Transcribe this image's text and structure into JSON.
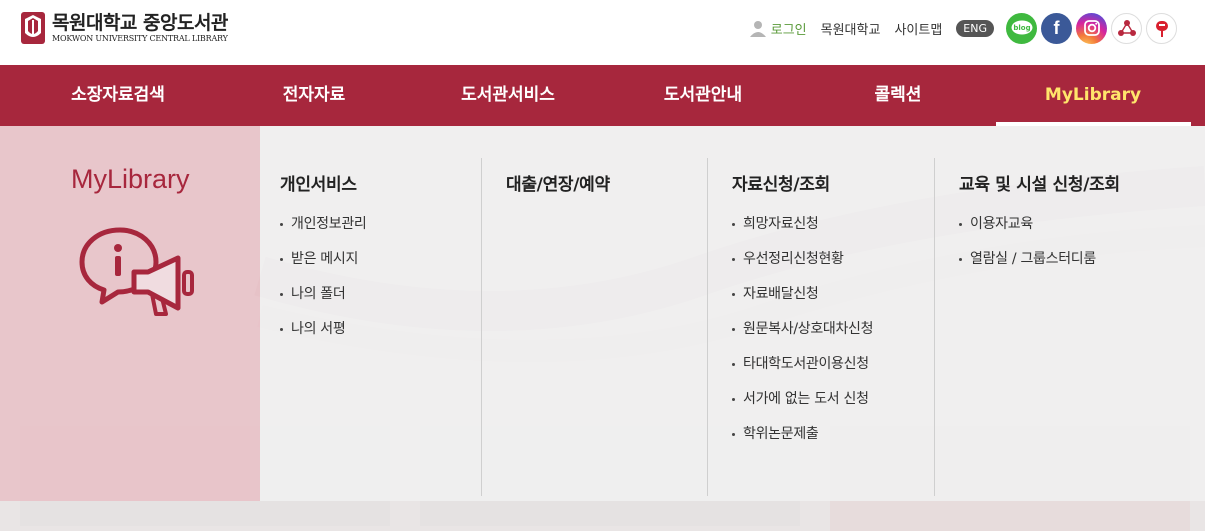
{
  "header": {
    "logo_kr": "목원대학교 중앙도서관",
    "logo_en": "MOKWON UNIVERSITY CENTRAL LIBRARY",
    "util": {
      "login": "로그인",
      "university": "목원대학교",
      "sitemap": "사이트맵",
      "lang": "ENG"
    },
    "sns": [
      {
        "name": "blog-icon",
        "glyph": "blog"
      },
      {
        "name": "facebook-icon",
        "glyph": "f"
      },
      {
        "name": "instagram-icon",
        "glyph": ""
      },
      {
        "name": "share-icon",
        "glyph": ""
      },
      {
        "name": "mailbox-icon",
        "glyph": ""
      }
    ]
  },
  "gnb": {
    "items": [
      {
        "label": "소장자료검색",
        "active": false
      },
      {
        "label": "전자자료",
        "active": false
      },
      {
        "label": "도서관서비스",
        "active": false
      },
      {
        "label": "도서관안내",
        "active": false
      },
      {
        "label": "콜렉션",
        "active": false
      },
      {
        "label": "MyLibrary",
        "active": true
      }
    ]
  },
  "mega": {
    "title": "MyLibrary",
    "icon": "megaphone-info-icon",
    "columns": [
      {
        "title": "개인서비스",
        "items": [
          "개인정보관리",
          "받은 메시지",
          "나의 폴더",
          "나의 서평"
        ]
      },
      {
        "title": "대출/연장/예약",
        "items": []
      },
      {
        "title": "자료신청/조회",
        "items": [
          "희망자료신청",
          "우선정리신청현황",
          "자료배달신청",
          "원문복사/상호대차신청",
          "타대학도서관이용신청",
          "서가에 없는 도서 신청",
          "학위논문제출"
        ]
      },
      {
        "title": "교육 및 시설 신청/조회",
        "items": [
          "이용자교육",
          "열람실 / 그룹스터디룸"
        ]
      }
    ]
  },
  "colors": {
    "brand": "#a7273d",
    "active_menu": "#ffe56b",
    "login": "#5a9a3a"
  }
}
